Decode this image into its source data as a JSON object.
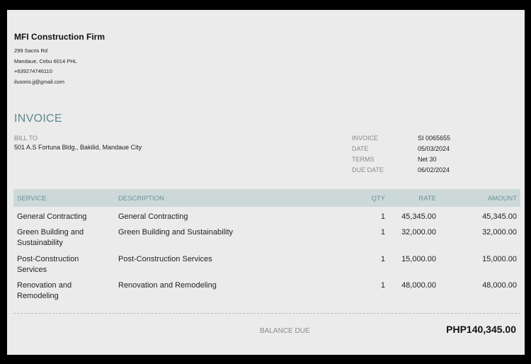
{
  "company": {
    "name": "MFI Construction Firm",
    "address_line1": "299 Sacris Rd",
    "address_line2": "Mandaue, Cebu  6014 PHL",
    "phone": "+639274746110",
    "email": "ilusorio.jj@gmail.com"
  },
  "invoice_title": "INVOICE",
  "bill_to": {
    "label": "BILL TO",
    "address": "501 A.S Fortuna Bldg., Bakilid, Mandaue City"
  },
  "meta": [
    {
      "label": "INVOICE",
      "value": "SI 0065655"
    },
    {
      "label": "DATE",
      "value": "05/03/2024"
    },
    {
      "label": "TERMS",
      "value": "Net 30"
    },
    {
      "label": "DUE DATE",
      "value": "06/02/2024"
    }
  ],
  "table": {
    "headers": {
      "service": "SERVICE",
      "description": "DESCRIPTION",
      "qty": "QTY",
      "rate": "RATE",
      "amount": "AMOUNT"
    },
    "rows": [
      {
        "service": "General Contracting",
        "description": "General Contracting",
        "qty": "1",
        "rate": "45,345.00",
        "amount": "45,345.00"
      },
      {
        "service": "Green Building and Sustainability",
        "description": "Green Building and Sustainability",
        "qty": "1",
        "rate": "32,000.00",
        "amount": "32,000.00"
      },
      {
        "service": "Post-Construction Services",
        "description": "Post-Construction Services",
        "qty": "1",
        "rate": "15,000.00",
        "amount": "15,000.00"
      },
      {
        "service": "Renovation and Remodeling",
        "description": "Renovation and Remodeling",
        "qty": "1",
        "rate": "48,000.00",
        "amount": "48,000.00"
      }
    ]
  },
  "balance": {
    "label": "BALANCE DUE",
    "value": "PHP140,345.00"
  }
}
